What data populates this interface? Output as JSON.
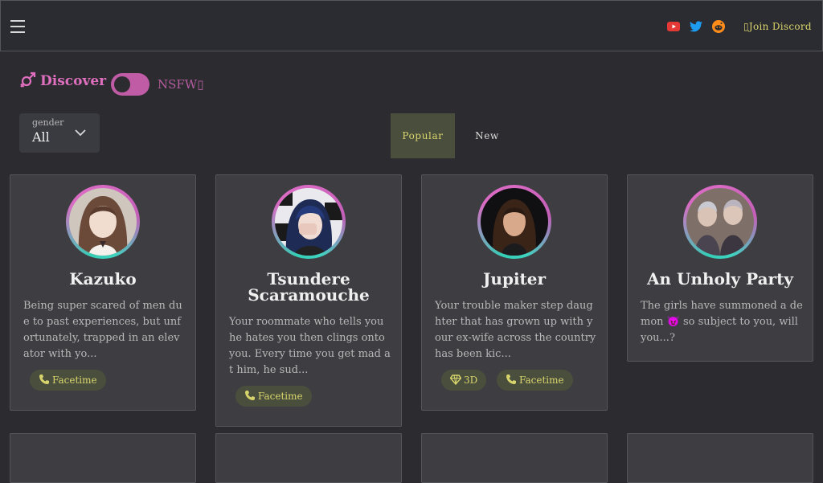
{
  "header": {
    "menu_icon": "hamburger-icon",
    "socials": [
      {
        "name": "youtube-icon",
        "color": "#e53935"
      },
      {
        "name": "twitter-icon",
        "color": "#1d9bf0"
      },
      {
        "name": "reddit-icon",
        "color": "#ff8c1a"
      }
    ],
    "join_label": "Join Discord"
  },
  "discover": {
    "title": "Discover",
    "icon": "gender-icon",
    "nsfw_label": "NSFW",
    "nsfw_enabled": true
  },
  "filter": {
    "gender_label": "gender",
    "gender_value": "All"
  },
  "tabs": [
    {
      "label": "Popular",
      "active": true
    },
    {
      "label": "New",
      "active": false
    }
  ],
  "cards": [
    {
      "name": "Kazuko",
      "description": "Being super scared of men due to past experiences, but unfortunately, trapped in an elevator with yo...",
      "tags": [
        {
          "label": "Facetime",
          "icon": "phone-icon"
        }
      ]
    },
    {
      "name": "Tsundere Scaramouche",
      "description": "Your roommate who tells you he hates you then clings onto you. Every time you get mad at him, he sud...",
      "tags": [
        {
          "label": "Facetime",
          "icon": "phone-icon"
        }
      ]
    },
    {
      "name": "Jupiter",
      "description": "Your trouble maker step daughter that has grown up with your ex-wife across the country has been kic...",
      "tags": [
        {
          "label": "3D",
          "icon": "diamond-icon"
        },
        {
          "label": "Facetime",
          "icon": "phone-icon"
        }
      ]
    },
    {
      "name": "An Unholy Party",
      "description": "The girls have summoned a demon 😈 so subject to you, will you...?",
      "tags": []
    }
  ],
  "colors": {
    "accent_pink": "#e06fbf",
    "accent_yellow": "#d9d46c",
    "background": "#2c2c30",
    "card": "#3d3d42"
  }
}
